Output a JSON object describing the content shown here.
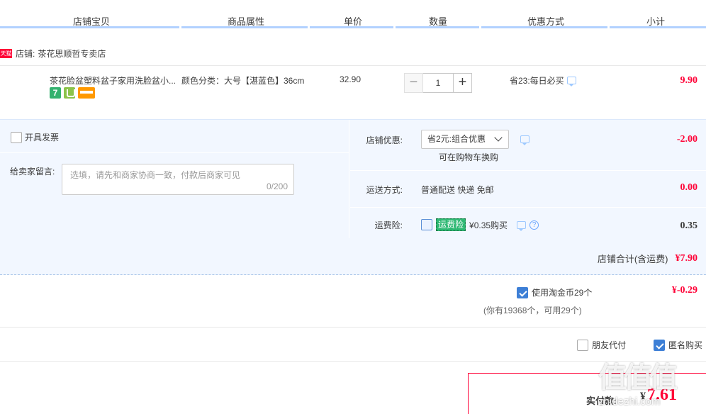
{
  "table_header": {
    "columns": [
      "店铺宝贝",
      "商品属性",
      "单价",
      "数量",
      "优惠方式",
      "小计"
    ]
  },
  "shop": {
    "badge": "天猫",
    "label": "店铺:",
    "name": "茶花思顺哲专卖店"
  },
  "item": {
    "title": "茶花脸盆塑料盆子家用洗脸盆小...",
    "attribute": "颜色分类：大号【湛蓝色】36cm",
    "price": "32.90",
    "quantity": "1",
    "qty_minus": "−",
    "qty_plus": "+",
    "promo": "省23:每日必买",
    "subtotal": "9.90",
    "badge_7": "7",
    "icons": [
      "seven-day-return-icon",
      "cup-badge-icon",
      "card-payment-icon"
    ]
  },
  "invoice": {
    "label": "开具发票",
    "checked": false
  },
  "message": {
    "label": "给卖家留言:",
    "placeholder": "选填，请先和商家协商一致，付款后商家可见",
    "count": "0/200"
  },
  "shop_discount": {
    "label": "店铺优惠:",
    "selected": "省2元:组合优惠",
    "swap_link": "可在购物车换购",
    "amount": "-2.00"
  },
  "shipping": {
    "label": "运送方式:",
    "value": "普通配送 快递 免邮",
    "amount": "0.00"
  },
  "insurance": {
    "label": "运费险:",
    "tag": "运费险",
    "price_text": "¥0.35购买",
    "amount": "0.35",
    "checked": false
  },
  "shop_total": {
    "label": "店铺合计(含运费)",
    "amount": "¥7.90"
  },
  "coins": {
    "label": "使用淘金币29个",
    "note": "(你有19368个，可用29个)",
    "amount": "¥-0.29",
    "checked": true
  },
  "options": {
    "friend_pay": "朋友代付",
    "friend_checked": false,
    "anonymous": "匿名购买",
    "anonymous_checked": true
  },
  "payment": {
    "label": "实付款:",
    "currency": "¥",
    "amount": "7.61"
  },
  "watermark": {
    "logo": "值值值",
    "url": "zhidezhi.com"
  },
  "colors": {
    "accent_red": "#ff0036",
    "header_underline": "#b2d1ff",
    "panel_bg": "#f2f7ff",
    "checkbox_blue": "#3d7fd6",
    "insurance_green": "#2db872"
  }
}
